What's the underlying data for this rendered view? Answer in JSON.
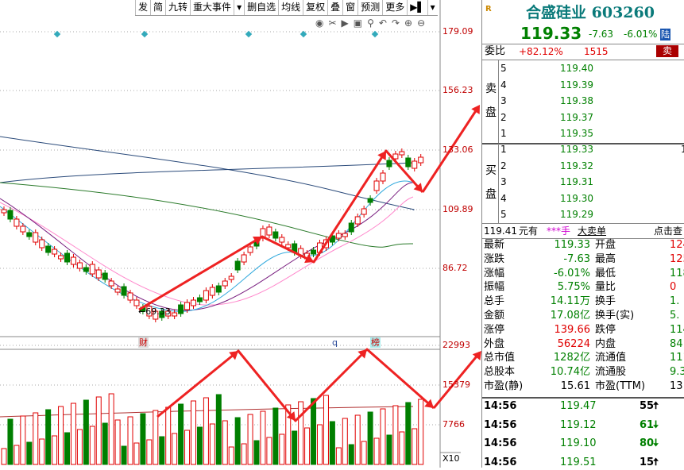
{
  "toolbar": {
    "items": [
      "发",
      "简",
      "九转",
      "重大事件",
      "▾",
      "删自选",
      "均线",
      "复权",
      "叠",
      "窗",
      "预测",
      "更多",
      "▶▌",
      "▾"
    ]
  },
  "chart": {
    "price_ticks": [
      "179.09",
      "156.23",
      "133.06",
      "109.89",
      "86.72"
    ],
    "volume_ticks": [
      "22993",
      "15379",
      "7766"
    ],
    "volume_unit": "X10",
    "low_label": "69.33",
    "badge_cai": "财",
    "badge_q": "q",
    "badge_bang": "榜",
    "colors": {
      "up": "#e00000",
      "down": "#007f00",
      "ma_purple": "#7a2080",
      "ma_pink": "#ff88cc",
      "ma_blue": "#33aadd",
      "ma_green": "#2a7a2a",
      "ma_navy": "#2a4a7a",
      "diamond": "#33aabb"
    }
  },
  "header": {
    "r_mark": "R",
    "name": "合盛硅业",
    "code": "603260",
    "price": "119.33",
    "change": "-7.63",
    "change_pct": "-6.01%",
    "market_badge": "陆"
  },
  "weibi": {
    "label": "委比",
    "pct": "+82.12%",
    "diff": "1515",
    "sell_btn": "卖"
  },
  "sell_side": {
    "label_chars": [
      "卖",
      "盘"
    ],
    "levels": [
      {
        "n": "5",
        "price": "119.40"
      },
      {
        "n": "4",
        "price": "119.39"
      },
      {
        "n": "3",
        "price": "119.38"
      },
      {
        "n": "2",
        "price": "119.37"
      },
      {
        "n": "1",
        "price": "119.35"
      }
    ]
  },
  "buy_side": {
    "label_chars": [
      "买",
      "盘"
    ],
    "levels": [
      {
        "n": "1",
        "price": "119.33",
        "vol": "1"
      },
      {
        "n": "2",
        "price": "119.32",
        "vol": ""
      },
      {
        "n": "3",
        "price": "119.31",
        "vol": ""
      },
      {
        "n": "4",
        "price": "119.30",
        "vol": ""
      },
      {
        "n": "5",
        "price": "119.29",
        "vol": ""
      }
    ]
  },
  "big_order": {
    "price": "119.41",
    "text1": "元有",
    "stars": "***手",
    "text2": "大卖单",
    "link": "点击查"
  },
  "stats": [
    {
      "l1": "最新",
      "v1": "119.33",
      "c1": "green",
      "l2": "开盘",
      "v2": "124",
      "c2": "red"
    },
    {
      "l1": "涨跌",
      "v1": "-7.63",
      "c1": "green",
      "l2": "最高",
      "v2": "125",
      "c2": "red"
    },
    {
      "l1": "涨幅",
      "v1": "-6.01%",
      "c1": "green",
      "l2": "最低",
      "v2": "118",
      "c2": "green"
    },
    {
      "l1": "振幅",
      "v1": "5.75%",
      "c1": "green",
      "l2": "量比",
      "v2": "0",
      "c2": "red"
    },
    {
      "l1": "总手",
      "v1": "14.11万",
      "c1": "green",
      "l2": "换手",
      "v2": "1.",
      "c2": "green"
    },
    {
      "l1": "金额",
      "v1": "17.08亿",
      "c1": "green",
      "l2": "换手(实)",
      "v2": "5.",
      "c2": "green"
    },
    {
      "l1": "涨停",
      "v1": "139.66",
      "c1": "red",
      "l2": "跌停",
      "v2": "114",
      "c2": "green"
    },
    {
      "l1": "外盘",
      "v1": "56224",
      "c1": "red",
      "l2": "内盘",
      "v2": "84",
      "c2": "green"
    },
    {
      "l1": "总市值",
      "v1": "1282亿",
      "c1": "green",
      "l2": "流通值",
      "v2": "111",
      "c2": "green"
    },
    {
      "l1": "总股本",
      "v1": "10.74亿",
      "c1": "green",
      "l2": "流通股",
      "v2": "9.3",
      "c2": "green"
    },
    {
      "l1": "市盈(静)",
      "v1": "15.61",
      "c1": "black",
      "l2": "市盈(TTM)",
      "v2": "13",
      "c2": "black"
    }
  ],
  "ticks": [
    {
      "time": "14:56",
      "price": "119.47",
      "vol": "55",
      "dir": "up"
    },
    {
      "time": "14:56",
      "price": "119.12",
      "vol": "61",
      "dir": "down"
    },
    {
      "time": "14:56",
      "price": "119.10",
      "vol": "80",
      "dir": "down"
    },
    {
      "time": "14:56",
      "price": "119.51",
      "vol": "15",
      "dir": "up"
    }
  ]
}
